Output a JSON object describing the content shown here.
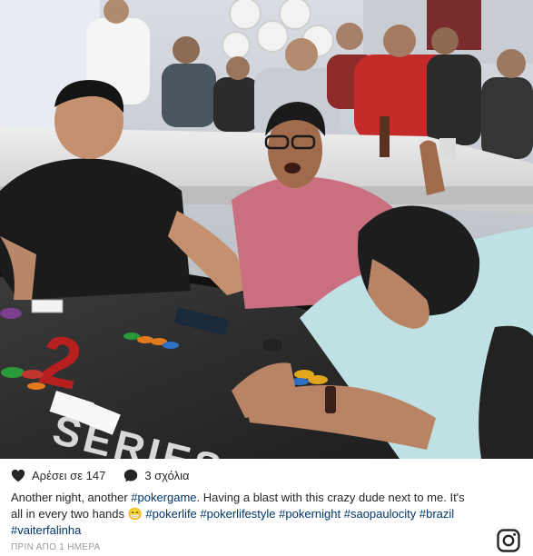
{
  "post": {
    "likes_label": "Αρέσει σε 147",
    "comments_label": "3 σχόλια",
    "caption_parts": [
      {
        "text": "Another night, another ",
        "tag": false
      },
      {
        "text": "#pokergame",
        "tag": true
      },
      {
        "text": ". Having a blast with this crazy dude next to me. It's all in every two hands 😁 ",
        "tag": false
      },
      {
        "text": "#pokerlife",
        "tag": true
      },
      {
        "text": " ",
        "tag": false
      },
      {
        "text": "#pokerlifestyle",
        "tag": true
      },
      {
        "text": " ",
        "tag": false
      },
      {
        "text": "#pokernight",
        "tag": true
      },
      {
        "text": " ",
        "tag": false
      },
      {
        "text": "#saopaulocity",
        "tag": true
      },
      {
        "text": " ",
        "tag": false
      },
      {
        "text": "#brazil",
        "tag": true
      },
      {
        "text": " ",
        "tag": false
      },
      {
        "text": "#vaiterfalinha",
        "tag": true
      }
    ],
    "timestamp": "ΠΡΙΝ ΑΠΟ 1 ΗΜΕΡΑ",
    "table_logo_text": "SERIES"
  },
  "icons": {
    "like": "heart-icon",
    "comment": "comment-bubble-icon",
    "brand": "instagram-logo-icon"
  },
  "colors": {
    "text": "#262626",
    "hashtag": "#003569",
    "muted": "#999999",
    "table_felt": "#2a2a2a",
    "table_logo_red": "#c0201f"
  }
}
